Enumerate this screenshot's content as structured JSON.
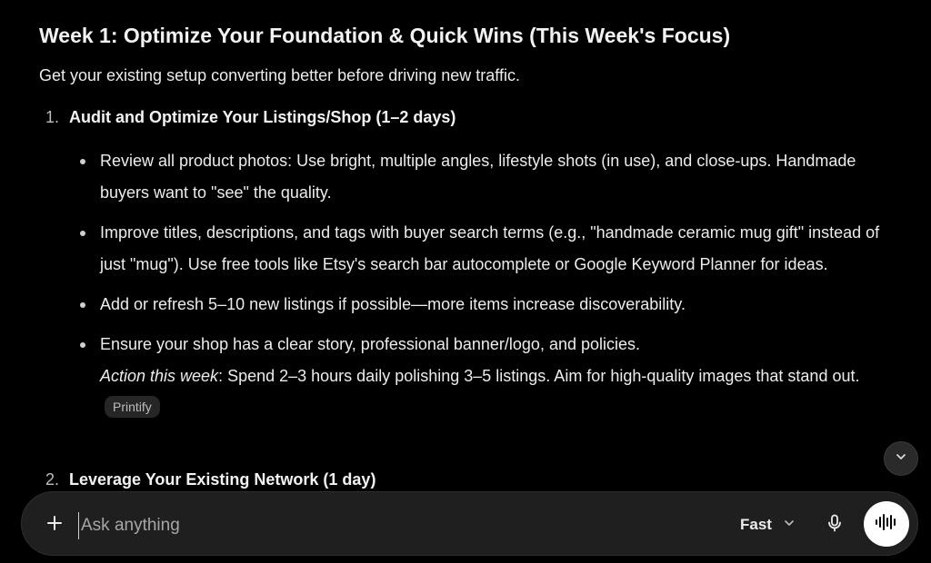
{
  "heading": "Week 1: Optimize Your Foundation & Quick Wins (This Week's Focus)",
  "intro": "Get your existing setup converting better before driving new traffic.",
  "steps": [
    {
      "number": "1.",
      "title": "Audit and Optimize Your Listings/Shop (1–2 days)"
    },
    {
      "number": "2.",
      "title": "Leverage Your Existing Network (1 day)"
    }
  ],
  "bullets": [
    {
      "text": "Review all product photos: Use bright, multiple angles, lifestyle shots (in use), and close-ups. Handmade buyers want to \"see\" the quality."
    },
    {
      "text": "Improve titles, descriptions, and tags with buyer search terms (e.g., \"handmade ceramic mug gift\" instead of just \"mug\"). Use free tools like Etsy's search bar autocomplete or Google Keyword Planner for ideas."
    },
    {
      "text": "Add or refresh 5–10 new listings if possible—more items increase discoverability."
    },
    {
      "text": "Ensure your shop has a clear story, professional banner/logo, and policies.",
      "action_label": "Action this week",
      "action_text": ": Spend 2–3 hours daily polishing 3–5 listings. Aim for high-quality images that stand out.",
      "source_chip": "Printify"
    }
  ],
  "composer": {
    "placeholder": "Ask anything",
    "value": "",
    "model_label": "Fast"
  },
  "icons": {
    "scroll_down": "chevron-down-icon",
    "attach": "plus-icon",
    "model_dropdown": "chevron-down-icon",
    "dictate": "microphone-icon",
    "voice_mode": "sound-wave-icon"
  },
  "colors": {
    "background": "#000000",
    "composer_bg": "#1f1f1f",
    "voice_button_bg": "#ffffff"
  }
}
